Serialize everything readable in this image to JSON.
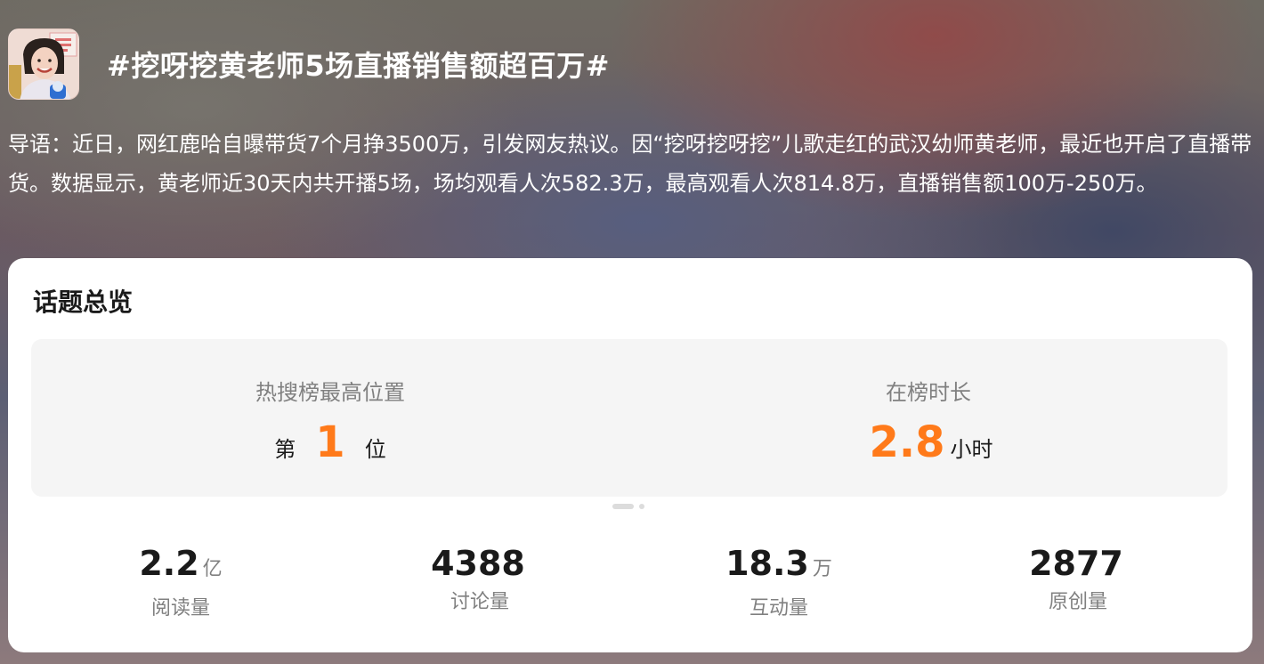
{
  "header": {
    "title": "#挖呀挖黄老师5场直播销售额超百万#"
  },
  "intro": {
    "text": "导语：近日，网红鹿哈自曝带货7个月挣3500万，引发网友热议。因“挖呀挖呀挖”儿歌走红的武汉幼师黄老师，最近也开启了直播带货。数据显示，黄老师近30天内共开播5场，场均观看人次582.3万，最高观看人次814.8万，直播销售额100万-250万。"
  },
  "overview": {
    "title": "话题总览",
    "rank": {
      "label": "热搜榜最高位置",
      "prefix": "第",
      "value": "1",
      "suffix": "位"
    },
    "duration": {
      "label": "在榜时长",
      "value": "2.8",
      "suffix": "小时"
    },
    "pager": {
      "total": 2,
      "active": 1
    },
    "stats": [
      {
        "value": "2.2",
        "unit": "亿",
        "label": "阅读量"
      },
      {
        "value": "4388",
        "unit": "",
        "label": "讨论量"
      },
      {
        "value": "18.3",
        "unit": "万",
        "label": "互动量"
      },
      {
        "value": "2877",
        "unit": "",
        "label": "原创量"
      }
    ]
  },
  "colors": {
    "accent": "#ff7a1a",
    "card_bg": "#ffffff",
    "panel_bg": "#f5f5f5",
    "muted_text": "#808080"
  }
}
